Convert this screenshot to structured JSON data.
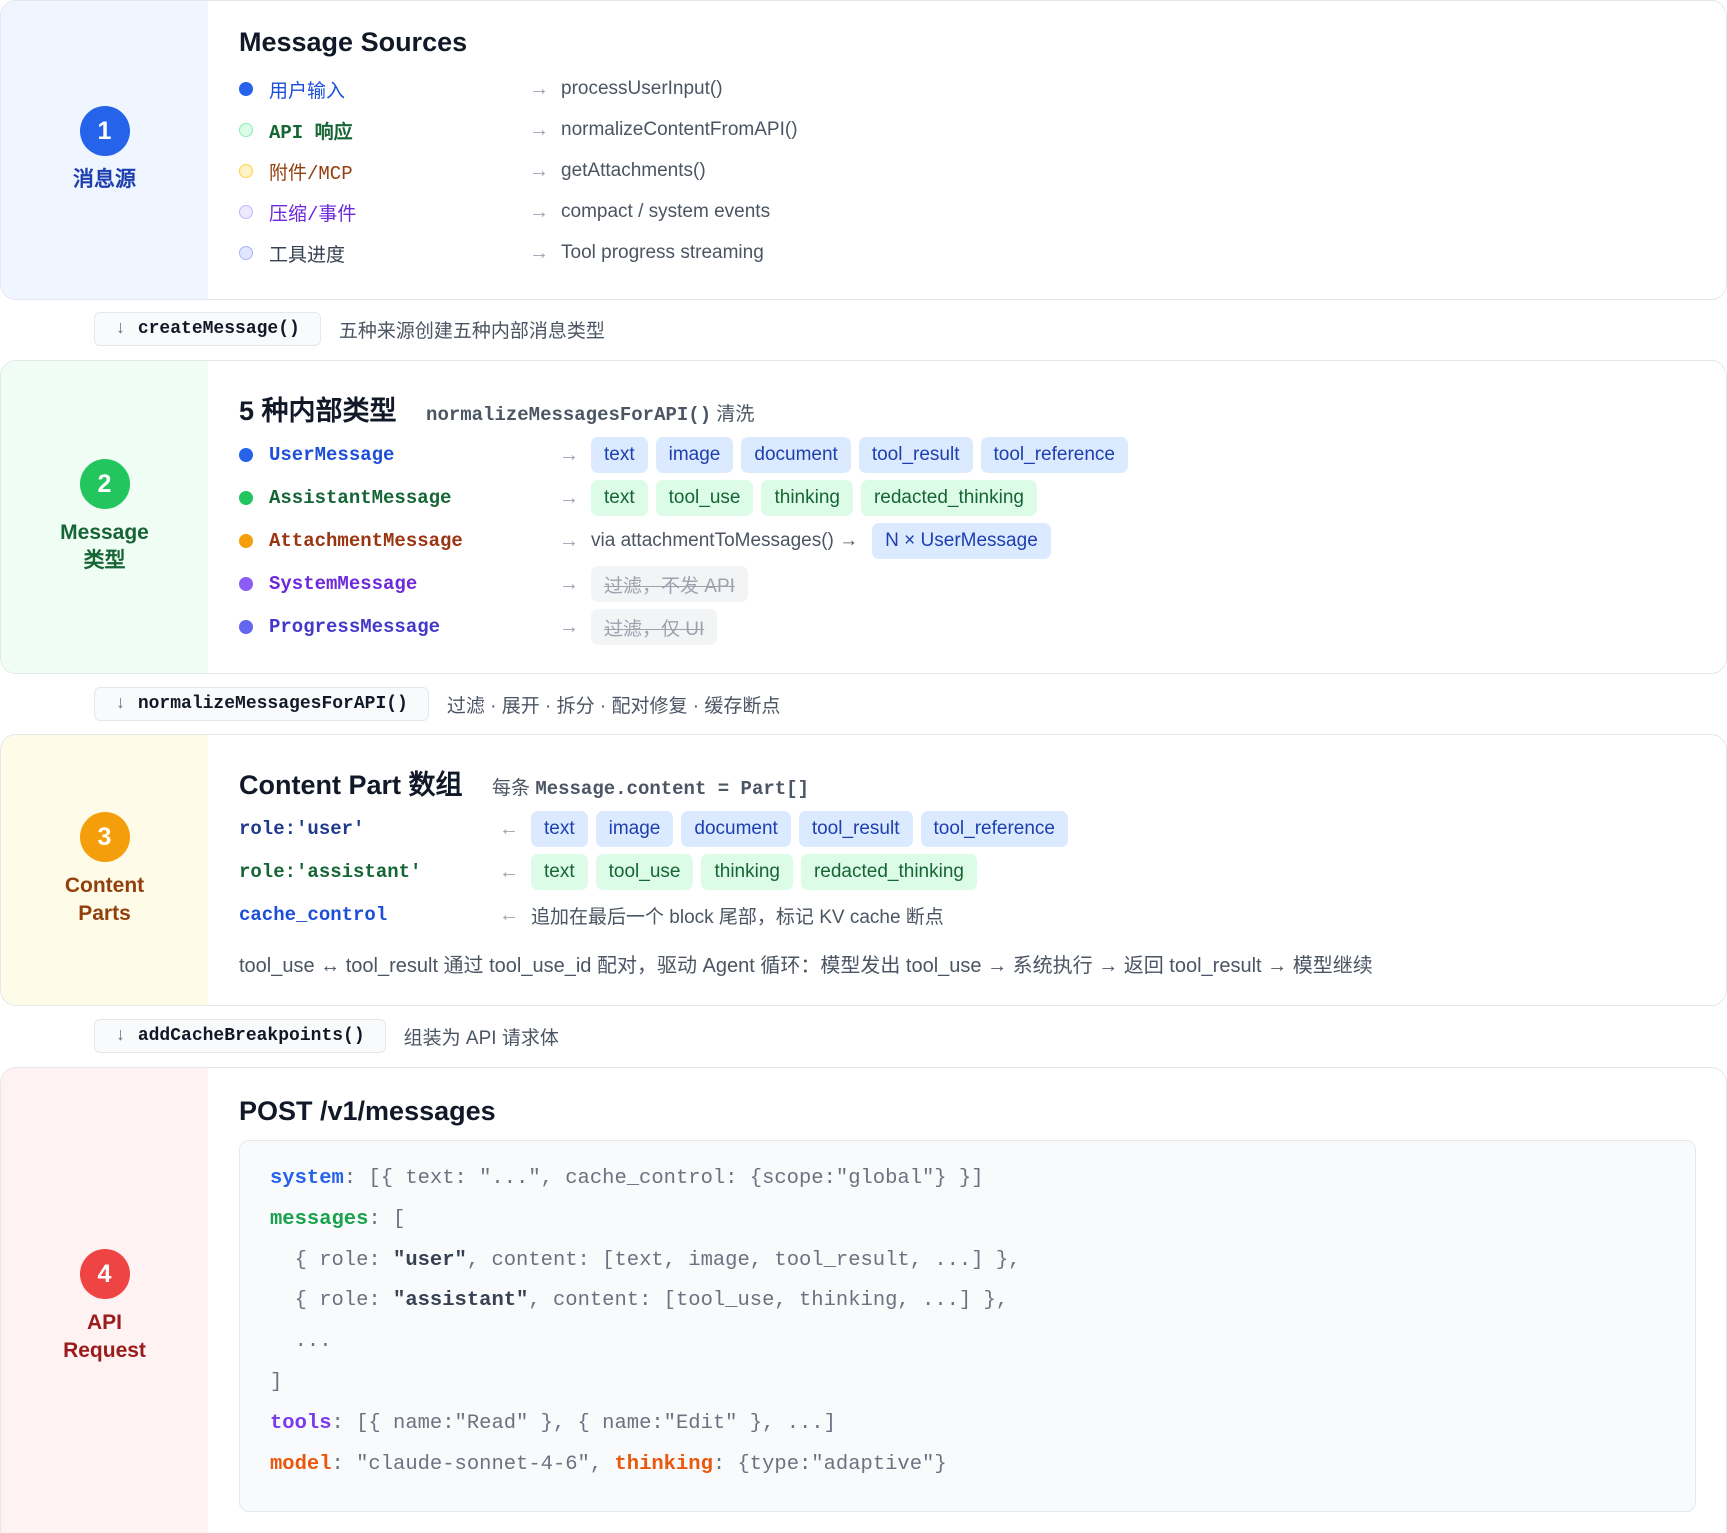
{
  "colors": {
    "blue": "#2563eb",
    "green": "#16a34a",
    "orange": "#f59e0b",
    "red": "#ef4444",
    "purple": "#7c3aed"
  },
  "stage1": {
    "number": "1",
    "label": "消息源",
    "title": "Message Sources",
    "rows": [
      {
        "name": "用户输入",
        "target": "processUserInput()"
      },
      {
        "name": "API 响应",
        "target": "normalizeContentFromAPI()"
      },
      {
        "name": "附件/MCP",
        "target": "getAttachments()"
      },
      {
        "name": "压缩/事件",
        "target": "compact / system events"
      },
      {
        "name": "工具进度",
        "target": "Tool progress streaming"
      }
    ]
  },
  "connector1": {
    "func": "createMessage()",
    "note": "五种来源创建五种内部消息类型"
  },
  "stage2": {
    "number": "2",
    "label_line1": "Message",
    "label_line2": "类型",
    "title": "5 种内部类型",
    "title_code": "normalizeMessagesForAPI()",
    "title_note": "清洗",
    "rows": [
      {
        "name": "UserMessage",
        "chips": [
          "text",
          "image",
          "document",
          "tool_result",
          "tool_reference"
        ]
      },
      {
        "name": "AssistantMessage",
        "chips": [
          "text",
          "tool_use",
          "thinking",
          "redacted_thinking"
        ]
      },
      {
        "name": "AttachmentMessage",
        "via": "via attachmentToMessages() →",
        "chip": "N × UserMessage"
      },
      {
        "name": "SystemMessage",
        "filtered": "过滤，不发 API"
      },
      {
        "name": "ProgressMessage",
        "filtered": "过滤，仅 UI"
      }
    ]
  },
  "connector2": {
    "func": "normalizeMessagesForAPI()",
    "note": "过滤 · 展开 · 拆分 · 配对修复 · 缓存断点"
  },
  "stage3": {
    "number": "3",
    "label_line1": "Content",
    "label_line2": "Parts",
    "title": "Content Part 数组",
    "title_note": "每条",
    "title_code": "Message.content = Part[]",
    "rows": [
      {
        "name": "role:'user'",
        "chips": [
          "text",
          "image",
          "document",
          "tool_result",
          "tool_reference"
        ]
      },
      {
        "name": "role:'assistant'",
        "chips": [
          "text",
          "tool_use",
          "thinking",
          "redacted_thinking"
        ]
      },
      {
        "name": "cache_control",
        "text": "追加在最后一个 block 尾部，标记 KV cache 断点"
      }
    ],
    "footer": "tool_use ↔ tool_result 通过 tool_use_id 配对，驱动 Agent 循环：模型发出 tool_use → 系统执行 → 返回 tool_result → 模型继续"
  },
  "connector3": {
    "func": "addCacheBreakpoints()",
    "note": "组装为 API 请求体"
  },
  "stage4": {
    "number": "4",
    "label_line1": "API",
    "label_line2": "Request",
    "title": "POST /v1/messages",
    "code": {
      "system_key": "system",
      "system_val": ": [{ text: \"...\", cache_control: {scope:\"global\"} }]",
      "messages_key": "messages",
      "messages_open": ": [",
      "user_pre": "  { role: ",
      "user_role": "\"user\"",
      "user_post": ", content: [text, image, tool_result, ...] },",
      "assistant_pre": "  { role: ",
      "assistant_role": "\"assistant\"",
      "assistant_post": ", content: [tool_use, thinking, ...] },",
      "ellipsis": "  ...",
      "close": "]",
      "tools_key": "tools",
      "tools_val": ": [{ name:\"Read\" }, { name:\"Edit\" }, ...]",
      "model_key": "model",
      "model_val": ": \"claude-sonnet-4-6\", ",
      "thinking_key": "thinking",
      "thinking_val": ": {type:\"adaptive\"}"
    }
  }
}
